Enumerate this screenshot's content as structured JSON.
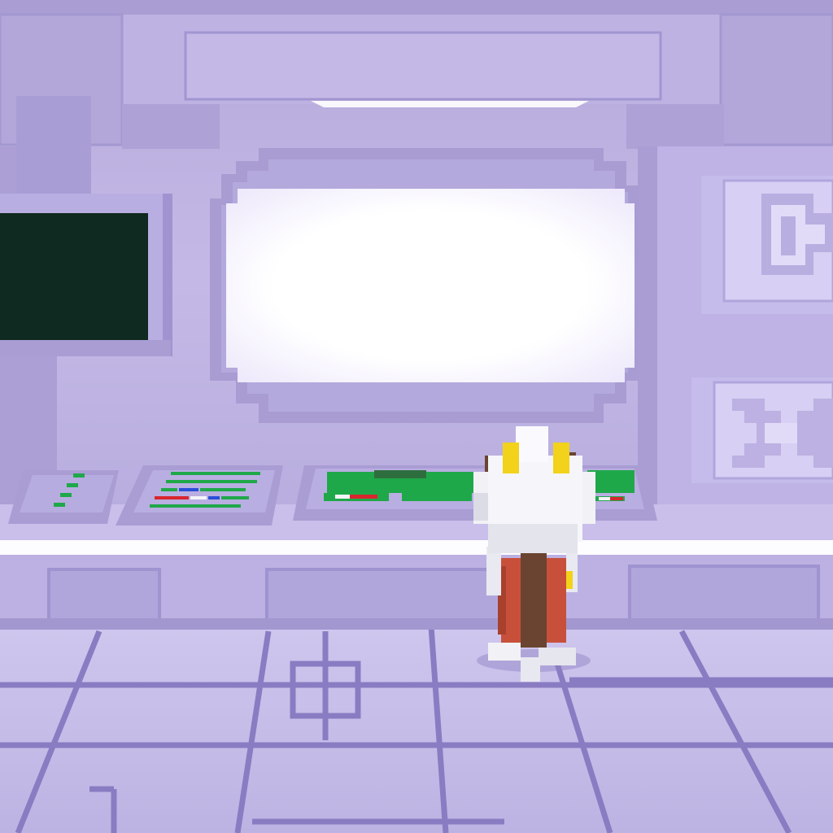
{
  "scene": {
    "kind": "voxel-spaceship-cockpit",
    "palette": {
      "wall": "#b8acdc",
      "wall_light": "#c9bfe8",
      "wall_dark": "#9487c6",
      "wall_shadow": "#8073b8",
      "floor": "#c7bfe7",
      "floor_line": "#8a7cc2",
      "glow": "#fdfcff",
      "monitor_screen": "#0f2a20",
      "panel_green": "#1fa84a",
      "panel_red": "#d8262e",
      "panel_blue": "#2a4fd8",
      "panel_white": "#f4f4f8",
      "astronaut_white": "#f2f2f6",
      "astronaut_yellow": "#f2d21a",
      "pack_red": "#c8503a",
      "strap_brown": "#6a4430"
    },
    "elements": {
      "viewport_window": "glowing-window",
      "left_monitor": "dark-monitor",
      "right_wall_icons": [
        "circuit-glyph-icon",
        "x-glyph-icon"
      ],
      "consoles": [
        "small-console",
        "striped-console",
        "main-console"
      ],
      "character": "astronaut-character"
    }
  }
}
